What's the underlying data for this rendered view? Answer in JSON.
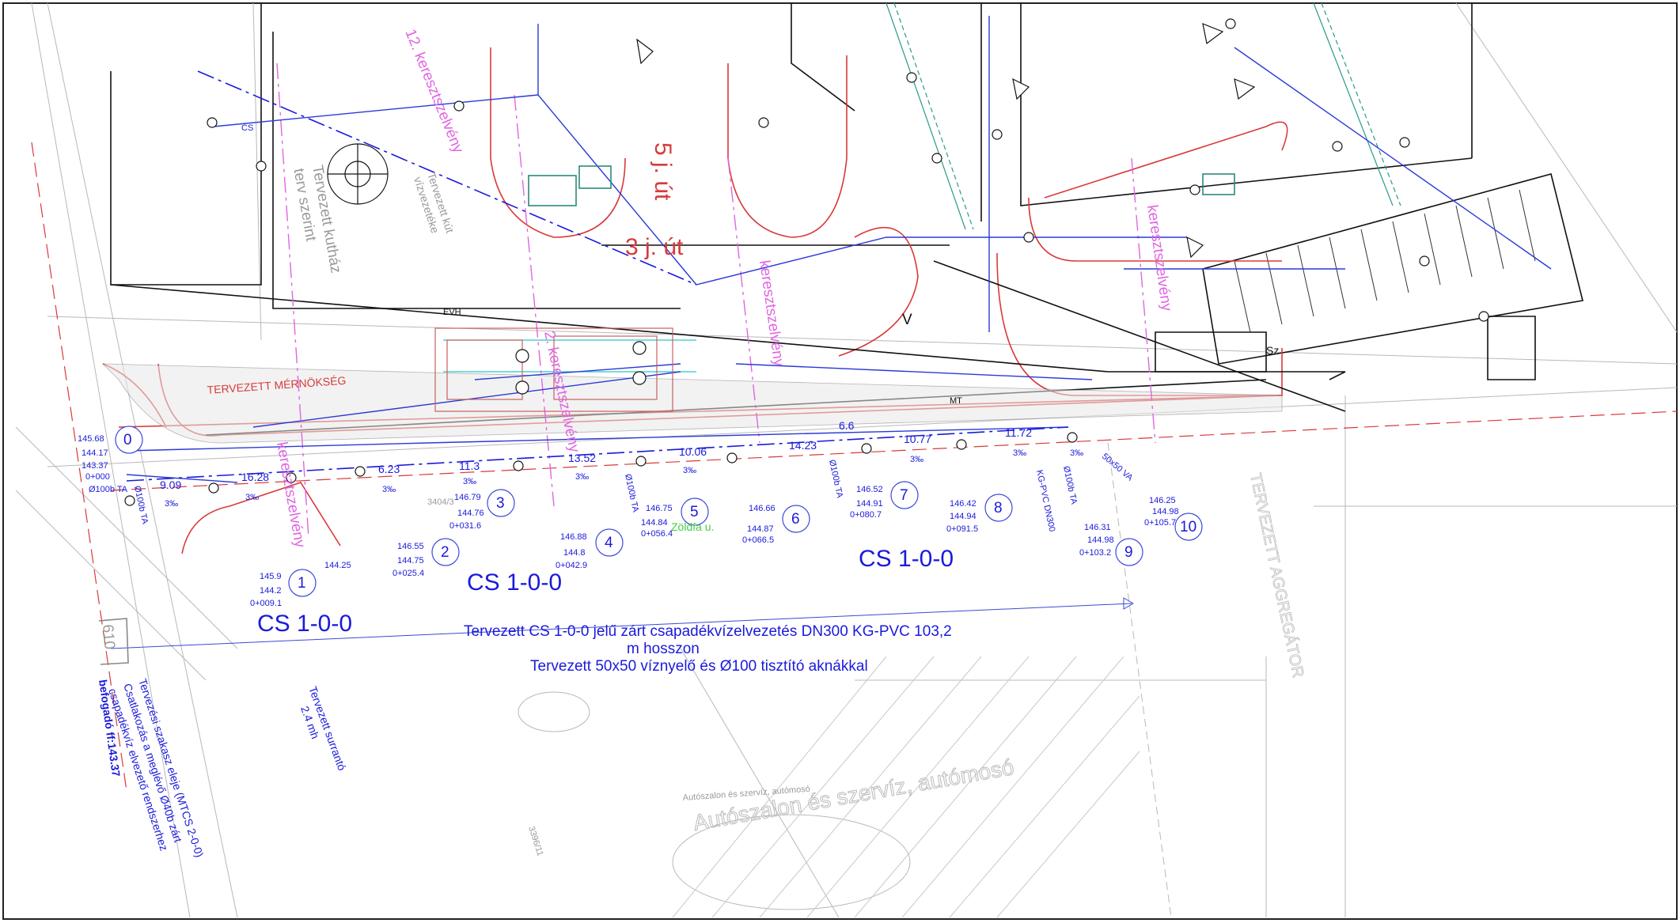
{
  "drawing": {
    "stations": [
      "0",
      "1",
      "2",
      "3",
      "4",
      "5",
      "6",
      "7",
      "8",
      "9",
      "10"
    ],
    "pipe_labels": [
      "CS 1-0-0",
      "CS 1-0-0",
      "CS 1-0-0"
    ],
    "segment_lengths": [
      "9.09",
      "16.28",
      "6.23",
      "11.3",
      "13.52",
      "10.06",
      "14.23",
      "10.77",
      "11.72",
      "6.6"
    ],
    "slopes": [
      "3‰",
      "3‰",
      "3‰",
      "3‰",
      "3‰",
      "3‰",
      "3‰",
      "3‰",
      "3‰"
    ],
    "station0": {
      "a": "145.68",
      "b": "144.17",
      "c": "143.37",
      "d": "0+000",
      "e": "Ø100b TA"
    },
    "station1": {
      "a": "145.9",
      "b": "144.2",
      "c": "0+009.1",
      "extra": "144.25"
    },
    "station2": {
      "a": "146.55",
      "b": "144.75",
      "c": "0+025.4"
    },
    "station3": {
      "a": "146.79",
      "b": "144.76",
      "c": "0+031.6"
    },
    "station4": {
      "a": "146.88",
      "b": "144.8",
      "c": "0+042.9"
    },
    "station5": {
      "a": "146.75",
      "b": "144.84",
      "c": "0+056.4"
    },
    "station6": {
      "a": "146.66",
      "b": "144.87",
      "c": "0+066.5"
    },
    "station7": {
      "a": "146.52",
      "b": "144.91",
      "c": "0+080.7"
    },
    "station8": {
      "a": "146.42",
      "b": "144.94",
      "c": "0+091.5"
    },
    "station9": {
      "a": "146.31",
      "b": "144.98",
      "c": "0+103.2"
    },
    "station10": {
      "a": "146.25",
      "b": "144.98",
      "c": "0+105.7"
    },
    "caption_main": "Tervezett CS 1-0-0 jelű zárt csapadékvízelvezetés DN300 KG-PVC 103,2",
    "caption_line2": "m hosszon",
    "caption_line3": "Tervezett 50x50 víznyelő és Ø100 tisztító aknákkal",
    "start_note_1": "Tervezési szakasz eleje (MTCS 2-0-0)",
    "start_note_2": "Csatlakozás a meglévő Ø40b zárt",
    "start_note_3": "csapadékvíz elvezető rendszerhez",
    "start_note_4": "befogadó ff:143.37",
    "surrant_1": "Tervezett surrantó",
    "surrant_2": "2.4 mh",
    "parcel_610": "610",
    "parcel_3404": "3404/3",
    "parcel_3396": "3396/11",
    "engineering": "TERVEZETT MÉRNÖKSÉG",
    "road_3j": "3 j. út",
    "road_5j": "5 j. út",
    "zoldfa": "Zöldfa u.",
    "autoszalon_1": "Autószalon és szervíz, autómosó",
    "autoszalon_2": "Autószalon és szervíz, autómosó",
    "aggregator": "TERVEZETT AGGREGÁTOR",
    "cross_sections": [
      "12. keresztszelvény",
      "2. keresztszelvény",
      "keresztszelvény",
      "keresztszelvény",
      "keresztszelvény"
    ],
    "kutnote": [
      "Tervezett kút",
      "vízvezetéke",
      "Tervezett kutház",
      "terv szerint"
    ],
    "utility_codes": [
      "CS",
      "EVH",
      "MT",
      "V",
      "Sz",
      "KG-PVC DN300",
      "Ø100b TA",
      "Ø100b TA",
      "Ø100b TA",
      "Ø100b TA",
      "50x50 VA"
    ]
  },
  "colors": {
    "pipe": "#1a1adc",
    "cross": "#e066e0",
    "red": "#d83a3a",
    "grey": "#9a9a9a",
    "black": "#111111",
    "teal": "#2a8a7a",
    "green": "#44cc44"
  }
}
